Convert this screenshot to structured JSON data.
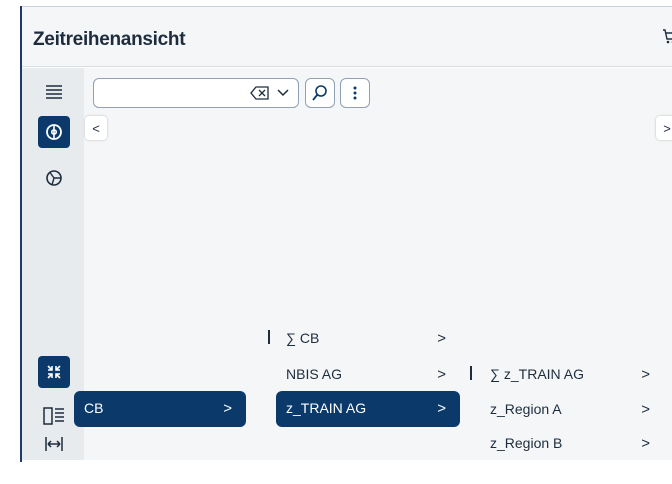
{
  "header": {
    "title": "Zeitreihenansicht"
  },
  "sidebar": {
    "items": [
      {
        "name": "menu-icon"
      },
      {
        "name": "globe-filter-icon",
        "active": true
      },
      {
        "name": "pie-chart-icon"
      },
      {
        "name": "collapse-all-icon",
        "active": true
      },
      {
        "name": "layout-panel-icon"
      },
      {
        "name": "fit-width-icon"
      }
    ]
  },
  "search": {
    "value": "",
    "placeholder": ""
  },
  "colors": {
    "primary": "#0b3a6a",
    "sidebar_bg": "#e8ebee",
    "content_bg": "#f5f6f7"
  },
  "tree": {
    "col1": [
      {
        "label": "CB",
        "selected": true
      }
    ],
    "col2": [
      {
        "label": "∑ CB",
        "selected": false
      },
      {
        "label": "NBIS AG",
        "selected": false
      },
      {
        "label": "z_TRAIN AG",
        "selected": true
      }
    ],
    "col3": [
      {
        "label": "∑ z_TRAIN AG",
        "selected": false
      },
      {
        "label": "z_Region A",
        "selected": false
      },
      {
        "label": "z_Region B",
        "selected": false
      }
    ],
    "chevron": ">"
  },
  "nav": {
    "left": "<",
    "right": ">"
  }
}
